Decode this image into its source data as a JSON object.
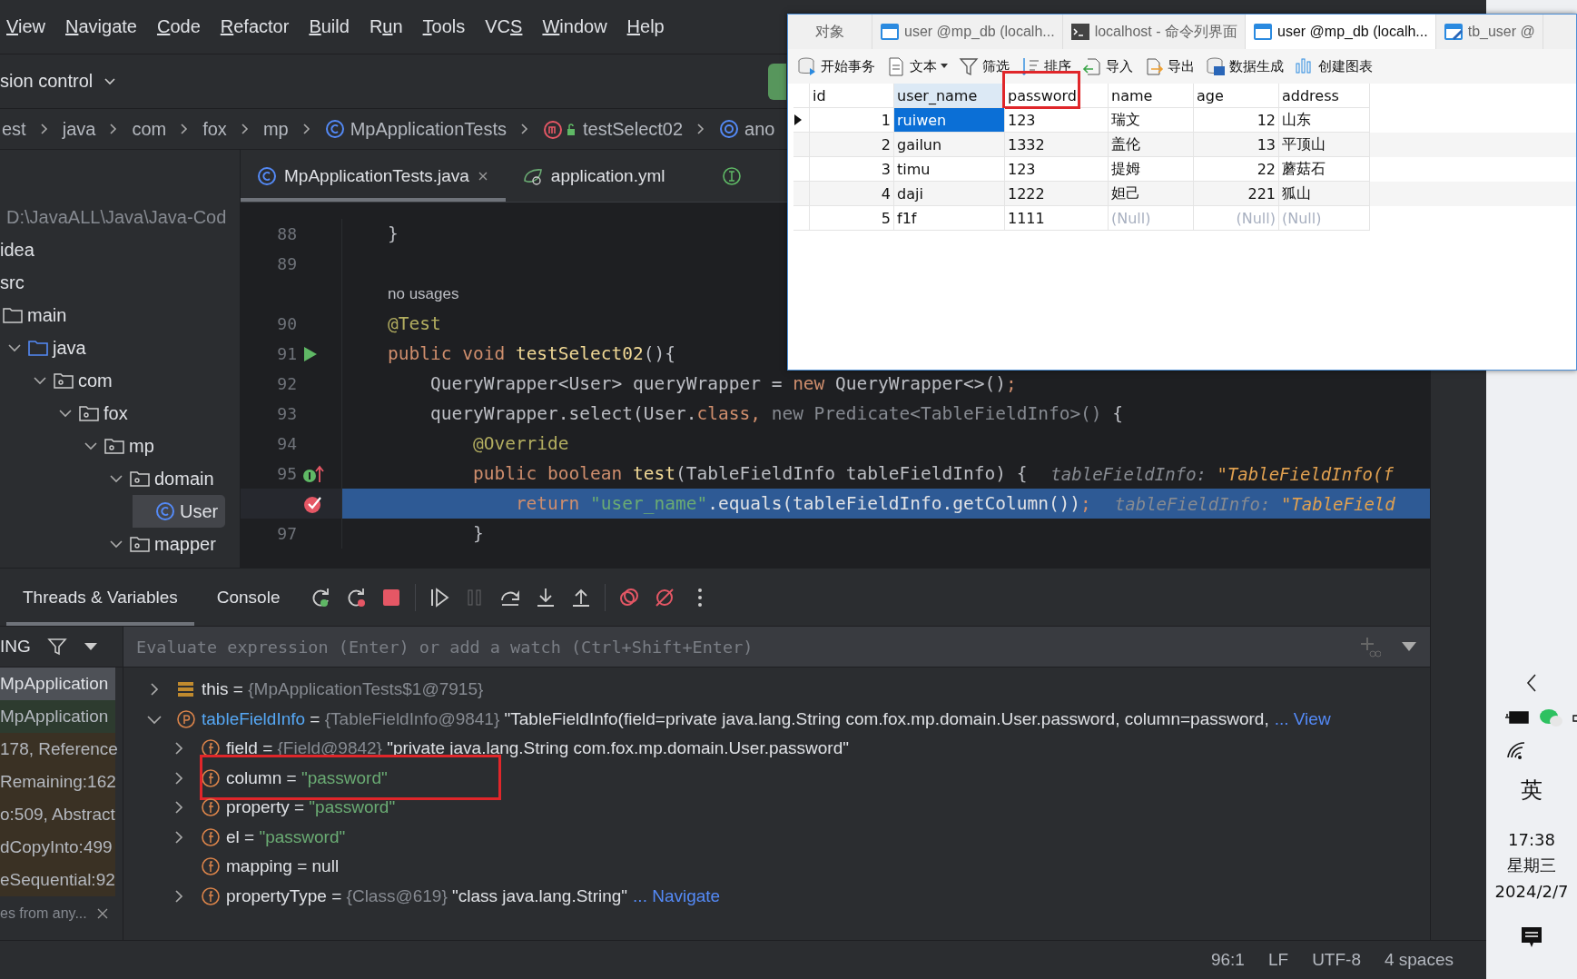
{
  "menu": [
    {
      "key": "V",
      "post": "iew"
    },
    {
      "key": "N",
      "post": "avigate"
    },
    {
      "key": "C",
      "post": "ode"
    },
    {
      "key": "R",
      "post": "efactor"
    },
    {
      "key": "B",
      "post": "uild"
    },
    {
      "pre": "R",
      "key": "u",
      "post": "n"
    },
    {
      "key": "T",
      "post": "ools"
    },
    {
      "pre": "VC",
      "key": "S"
    },
    {
      "key": "W",
      "post": "indow"
    },
    {
      "key": "H",
      "post": "elp"
    }
  ],
  "toolbar": {
    "vcs_label": "sion control"
  },
  "breadcrumbs": [
    {
      "label": "est",
      "kind": "folder"
    },
    {
      "label": "java",
      "kind": "folder"
    },
    {
      "label": "com",
      "kind": "folder"
    },
    {
      "label": "fox",
      "kind": "folder"
    },
    {
      "label": "mp",
      "kind": "folder"
    },
    {
      "label": "MpApplicationTests",
      "kind": "class"
    },
    {
      "label": "testSelect02",
      "kind": "method"
    },
    {
      "label": "ano",
      "kind": "anonymous"
    }
  ],
  "project_tree": [
    {
      "label": "D:\\JavaALL\\Java\\Java-Cod",
      "kind": "root",
      "selected": false,
      "children": [
        {
          "label": "idea",
          "selected": false
        },
        {
          "label": "src",
          "selected": false,
          "children": [
            {
              "label": "main",
              "kind": "folder",
              "selected": false,
              "children": [
                {
                  "label": "java",
                  "kind": "source",
                  "selected": false,
                  "expanded": true,
                  "children": [
                    {
                      "label": "com",
                      "kind": "package",
                      "selected": false,
                      "expanded": true,
                      "children": [
                        {
                          "label": "fox",
                          "kind": "package",
                          "selected": false,
                          "expanded": true,
                          "children": [
                            {
                              "label": "mp",
                              "kind": "package",
                              "selected": false,
                              "expanded": true,
                              "children": [
                                {
                                  "label": "domain",
                                  "kind": "package",
                                  "selected": false,
                                  "expanded": true,
                                  "children": [
                                    {
                                      "label": "User",
                                      "kind": "class",
                                      "selected": true
                                    }
                                  ]
                                },
                                {
                                  "label": "mapper",
                                  "kind": "package",
                                  "selected": false,
                                  "expanded": true
                                }
                              ]
                            }
                          ]
                        }
                      ]
                    }
                  ]
                }
              ]
            }
          ]
        }
      ]
    }
  ],
  "editor": {
    "tabs": [
      {
        "label": "MpApplicationTests.java",
        "kind": "class",
        "selected": true
      },
      {
        "label": "application.yml",
        "kind": "yaml",
        "selected": false
      }
    ],
    "lines": [
      {
        "number": "88",
        "selected": false,
        "code": [
          {
            "kind": "plain",
            "text": "}"
          }
        ]
      },
      {
        "number": "89",
        "selected": false
      },
      {
        "kind": "usages",
        "selected": false,
        "code": [
          {
            "kind": "plain",
            "text": "no usages"
          }
        ]
      },
      {
        "number": "90",
        "selected": false,
        "code": [
          {
            "kind": "annotation",
            "text": "@Test"
          }
        ]
      },
      {
        "number": "91",
        "selected": false,
        "marker": {
          "kind": "run"
        },
        "code": [
          {
            "kind": "keyword",
            "text": "public void "
          },
          {
            "kind": "method",
            "text": "testSelect02"
          },
          {
            "kind": "plain",
            "text": "(){"
          }
        ]
      },
      {
        "number": "92",
        "selected": false,
        "code": [
          {
            "kind": "plain",
            "text": "    QueryWrapper<User> queryWrapper = "
          },
          {
            "kind": "keyword",
            "text": "new"
          },
          {
            "kind": "plain",
            "text": " QueryWrapper<>()"
          },
          {
            "kind": "keyword",
            "text": ";"
          }
        ]
      },
      {
        "number": "93",
        "selected": false,
        "code": [
          {
            "kind": "plain",
            "text": "    queryWrapper.select(User."
          },
          {
            "kind": "keyword",
            "text": "class, "
          },
          {
            "kind": "muted",
            "text": "new Predicate<TableFieldInfo>()"
          },
          {
            "kind": "plain",
            "text": " {"
          }
        ]
      },
      {
        "number": "94",
        "selected": false,
        "code": [
          {
            "kind": "annotation",
            "text": "        @Override"
          }
        ]
      },
      {
        "number": "95",
        "selected": false,
        "marker": {
          "kind": "implements"
        },
        "code": [
          {
            "kind": "keyword",
            "text": "        public boolean "
          },
          {
            "kind": "method",
            "text": "test"
          },
          {
            "kind": "plain",
            "text": "(TableFieldInfo tableFieldInfo) {"
          }
        ],
        "hint": {
          "label": "tableFieldInfo: ",
          "value": "\"TableFieldInfo(f"
        }
      },
      {
        "selected": true,
        "marker": {
          "kind": "breakpoint"
        },
        "code": [
          {
            "kind": "keyword",
            "text": "            return "
          },
          {
            "kind": "string",
            "text": "\"user_name\""
          },
          {
            "kind": "plain",
            "text": ".equals(tableFieldInfo.getColumn())"
          },
          {
            "kind": "keyword",
            "text": ";"
          }
        ],
        "hint": {
          "label": "tableFieldInfo: ",
          "value": "\"TableField"
        }
      },
      {
        "number": "97",
        "selected": false,
        "code": [
          {
            "kind": "plain",
            "text": "        }"
          }
        ]
      }
    ]
  },
  "db_window": {
    "tabs": [
      {
        "label": "对象",
        "kind": "objects",
        "selected": false
      },
      {
        "label": "user @mp_db (localh...",
        "kind": "table",
        "selected": false
      },
      {
        "label": "localhost - 命令列界面",
        "kind": "console",
        "selected": false
      },
      {
        "label": "user @mp_db (localh...",
        "kind": "table",
        "selected": true
      },
      {
        "label": "tb_user @",
        "kind": "design",
        "selected": false
      }
    ],
    "toolbar": [
      {
        "label": "开始事务",
        "kind": "transaction"
      },
      {
        "label": "文本",
        "kind": "text",
        "dropdown": true
      },
      {
        "label": "筛选",
        "kind": "filter"
      },
      {
        "label": "排序",
        "kind": "sort"
      },
      {
        "label": "导入",
        "kind": "import"
      },
      {
        "label": "导出",
        "kind": "export"
      },
      {
        "label": "数据生成",
        "kind": "generate"
      },
      {
        "label": "创建图表",
        "kind": "chart"
      }
    ],
    "table": {
      "columns": [
        {
          "label": "id",
          "numeric": true,
          "highlighted": false
        },
        {
          "label": "user_name",
          "numeric": false,
          "highlighted": false
        },
        {
          "label": "password",
          "numeric": false,
          "highlighted": true
        },
        {
          "label": "name",
          "numeric": false,
          "highlighted": false
        },
        {
          "label": "age",
          "numeric": true,
          "highlighted": false
        },
        {
          "label": "address",
          "numeric": false,
          "highlighted": false
        }
      ],
      "rows": [
        {
          "current": true,
          "cells": [
            {
              "text": "1",
              "kind": "value",
              "selected": false
            },
            {
              "text": "ruiwen",
              "kind": "value",
              "selected": true
            },
            {
              "text": "123",
              "kind": "value",
              "selected": false
            },
            {
              "text": "瑞文",
              "kind": "value",
              "selected": false
            },
            {
              "text": "12",
              "kind": "value",
              "selected": false
            },
            {
              "text": "山东",
              "kind": "value",
              "selected": false
            }
          ]
        },
        {
          "current": false,
          "cells": [
            {
              "text": "2",
              "kind": "value",
              "selected": false
            },
            {
              "text": "gailun",
              "kind": "value",
              "selected": false
            },
            {
              "text": "1332",
              "kind": "value",
              "selected": false
            },
            {
              "text": "盖伦",
              "kind": "value",
              "selected": false
            },
            {
              "text": "13",
              "kind": "value",
              "selected": false
            },
            {
              "text": "平顶山",
              "kind": "value",
              "selected": false
            }
          ]
        },
        {
          "current": false,
          "cells": [
            {
              "text": "3",
              "kind": "value",
              "selected": false
            },
            {
              "text": "timu",
              "kind": "value",
              "selected": false
            },
            {
              "text": "123",
              "kind": "value",
              "selected": false
            },
            {
              "text": "提姆",
              "kind": "value",
              "selected": false
            },
            {
              "text": "22",
              "kind": "value",
              "selected": false
            },
            {
              "text": "蘑菇石",
              "kind": "value",
              "selected": false
            }
          ]
        },
        {
          "current": false,
          "cells": [
            {
              "text": "4",
              "kind": "value",
              "selected": false
            },
            {
              "text": "daji",
              "kind": "value",
              "selected": false
            },
            {
              "text": "1222",
              "kind": "value",
              "selected": false
            },
            {
              "text": "妲己",
              "kind": "value",
              "selected": false
            },
            {
              "text": "221",
              "kind": "value",
              "selected": false
            },
            {
              "text": "狐山",
              "kind": "value",
              "selected": false
            }
          ]
        },
        {
          "current": false,
          "cells": [
            {
              "text": "5",
              "kind": "value",
              "selected": false
            },
            {
              "text": "f1f",
              "kind": "value",
              "selected": false
            },
            {
              "text": "1111",
              "kind": "value",
              "selected": false
            },
            {
              "text": "(Null)",
              "kind": "null",
              "selected": false
            },
            {
              "text": "(Null)",
              "kind": "null",
              "selected": false
            },
            {
              "text": "(Null)",
              "kind": "null",
              "selected": false
            }
          ]
        }
      ]
    }
  },
  "debugger": {
    "tabs": [
      {
        "label": "Threads & Variables",
        "selected": true
      },
      {
        "label": "Console",
        "selected": false
      }
    ],
    "toolbar": [
      {
        "kind": "rerun",
        "disabled": false
      },
      {
        "kind": "restart",
        "disabled": false
      },
      {
        "kind": "stop",
        "disabled": false
      },
      {
        "kind": "resume",
        "disabled": false
      },
      {
        "kind": "pause",
        "disabled": true
      },
      {
        "kind": "step_over",
        "disabled": false
      },
      {
        "kind": "step_into",
        "disabled": false
      },
      {
        "kind": "step_out",
        "disabled": false
      },
      {
        "kind": "breakpoints",
        "disabled": false
      },
      {
        "kind": "mute",
        "disabled": false
      },
      {
        "kind": "more",
        "disabled": false
      }
    ],
    "frames": {
      "header": "ING",
      "items": [
        {
          "label": "MpApplication",
          "kind": "project",
          "selected": true
        },
        {
          "label": "MpApplication",
          "kind": "project",
          "selected": false
        },
        {
          "label": "178, Reference",
          "kind": "library",
          "selected": false
        },
        {
          "label": "Remaining:162",
          "kind": "library",
          "selected": false
        },
        {
          "label": "o:509, Abstract",
          "kind": "library",
          "selected": false
        },
        {
          "label": "dCopyInto:499",
          "kind": "library",
          "selected": false
        },
        {
          "label": "eSequential:92",
          "kind": "library",
          "selected": false
        }
      ],
      "footer": "es from any..."
    },
    "evaluate": {
      "placeholder": "Evaluate expression (Enter) or add a watch (Ctrl+Shift+Enter)"
    },
    "variables": [
      {
        "kind": "this",
        "name": "this",
        "operator": "=",
        "expandable": true,
        "expanded": false,
        "highlighted": false,
        "type": "{MpApplicationTests$1@7915}"
      },
      {
        "kind": "param",
        "name": "tableFieldInfo",
        "operator": "=",
        "expandable": true,
        "expanded": true,
        "highlighted": false,
        "type": "{TableFieldInfo@9841}",
        "value": {
          "text": "\"TableFieldInfo(field=private java.lang.String com.fox.mp.domain.User.password, column=password,",
          "kind": "object"
        },
        "link": "... View",
        "children": [
          {
            "kind": "field",
            "name": "field",
            "operator": "=",
            "expandable": true,
            "highlighted": false,
            "type": "{Field@9842}",
            "value": {
              "text": "\"private java.lang.String com.fox.mp.domain.User.password\"",
              "kind": "object"
            }
          },
          {
            "kind": "field",
            "name": "column",
            "operator": "=",
            "expandable": true,
            "highlighted": true,
            "value": {
              "text": "\"password\"",
              "kind": "string"
            }
          },
          {
            "kind": "field",
            "name": "property",
            "operator": "=",
            "expandable": true,
            "highlighted": false,
            "value": {
              "text": "\"password\"",
              "kind": "string"
            }
          },
          {
            "kind": "field",
            "name": "el",
            "operator": "=",
            "expandable": true,
            "highlighted": false,
            "value": {
              "text": "\"password\"",
              "kind": "string"
            }
          },
          {
            "kind": "field",
            "name": "mapping",
            "operator": "=",
            "expandable": false,
            "highlighted": false,
            "value": {
              "text": "null",
              "kind": "object"
            }
          },
          {
            "kind": "field",
            "name": "propertyType",
            "operator": "=",
            "expandable": true,
            "highlighted": false,
            "type": "{Class@619}",
            "value": {
              "text": "\"class java.lang.String\"",
              "kind": "object"
            },
            "link": "... Navigate"
          }
        ]
      }
    ]
  },
  "status_bar": [
    "96:1",
    "LF",
    "UTF-8",
    "4 spaces"
  ],
  "taskbar": {
    "input_method": "英",
    "time": "17:38",
    "weekday": "星期三",
    "date": "2024/2/7"
  }
}
